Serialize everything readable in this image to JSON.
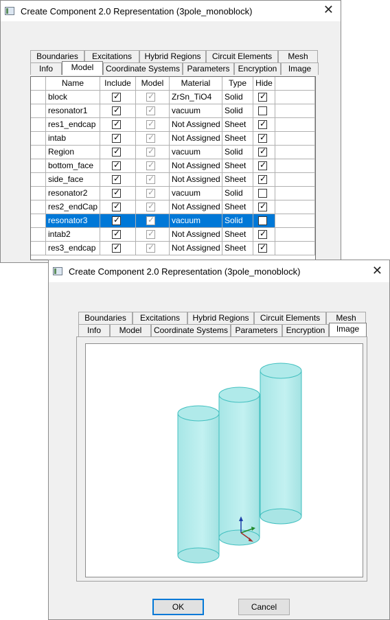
{
  "back_dialog": {
    "title": "Create Component 2.0 Representation (3pole_monoblock)",
    "tabs_back": [
      "Boundaries",
      "Excitations",
      "Hybrid Regions",
      "Circuit Elements",
      "Mesh"
    ],
    "tabs_front": [
      "Info",
      "Model",
      "Coordinate Systems",
      "Parameters",
      "Encryption",
      "Image"
    ],
    "active_tab": "Model",
    "columns": [
      "Name",
      "Include",
      "Model",
      "Material",
      "Type",
      "Hide"
    ],
    "rows": [
      {
        "name": "block",
        "include": true,
        "model": true,
        "material": "ZrSn_TiO4",
        "type": "Solid",
        "hide": true
      },
      {
        "name": "resonator1",
        "include": true,
        "model": true,
        "material": "vacuum",
        "type": "Solid",
        "hide": false
      },
      {
        "name": "res1_endcap",
        "include": true,
        "model": true,
        "material": "Not Assigned",
        "type": "Sheet",
        "hide": true
      },
      {
        "name": "intab",
        "include": true,
        "model": true,
        "material": "Not Assigned",
        "type": "Sheet",
        "hide": true
      },
      {
        "name": "Region",
        "include": true,
        "model": true,
        "material": "vacuum",
        "type": "Solid",
        "hide": true
      },
      {
        "name": "bottom_face",
        "include": true,
        "model": true,
        "material": "Not Assigned",
        "type": "Sheet",
        "hide": true
      },
      {
        "name": "side_face",
        "include": true,
        "model": true,
        "material": "Not Assigned",
        "type": "Sheet",
        "hide": true
      },
      {
        "name": "resonator2",
        "include": true,
        "model": true,
        "material": "vacuum",
        "type": "Solid",
        "hide": false
      },
      {
        "name": "res2_endCap",
        "include": true,
        "model": true,
        "material": "Not Assigned",
        "type": "Sheet",
        "hide": true
      },
      {
        "name": "resonator3",
        "include": true,
        "model": true,
        "material": "vacuum",
        "type": "Solid",
        "hide": false,
        "selected": true
      },
      {
        "name": "intab2",
        "include": true,
        "model": true,
        "material": "Not Assigned",
        "type": "Sheet",
        "hide": true
      },
      {
        "name": "res3_endcap",
        "include": true,
        "model": true,
        "material": "Not Assigned",
        "type": "Sheet",
        "hide": true
      }
    ]
  },
  "front_dialog": {
    "title": "Create Component 2.0 Representation (3pole_monoblock)",
    "tabs_back": [
      "Boundaries",
      "Excitations",
      "Hybrid Regions",
      "Circuit Elements",
      "Mesh"
    ],
    "tabs_front": [
      "Info",
      "Model",
      "Coordinate Systems",
      "Parameters",
      "Encryption",
      "Image"
    ],
    "active_tab": "Image",
    "ok_label": "OK",
    "cancel_label": "Cancel"
  },
  "icons": {
    "app": "window-app-icon",
    "close": "close-icon",
    "check": "checkmark-icon"
  },
  "colors": {
    "selection": "#0078d7",
    "cylinder_fill": "#b6ecec",
    "cylinder_stroke": "#3fbfbf"
  }
}
